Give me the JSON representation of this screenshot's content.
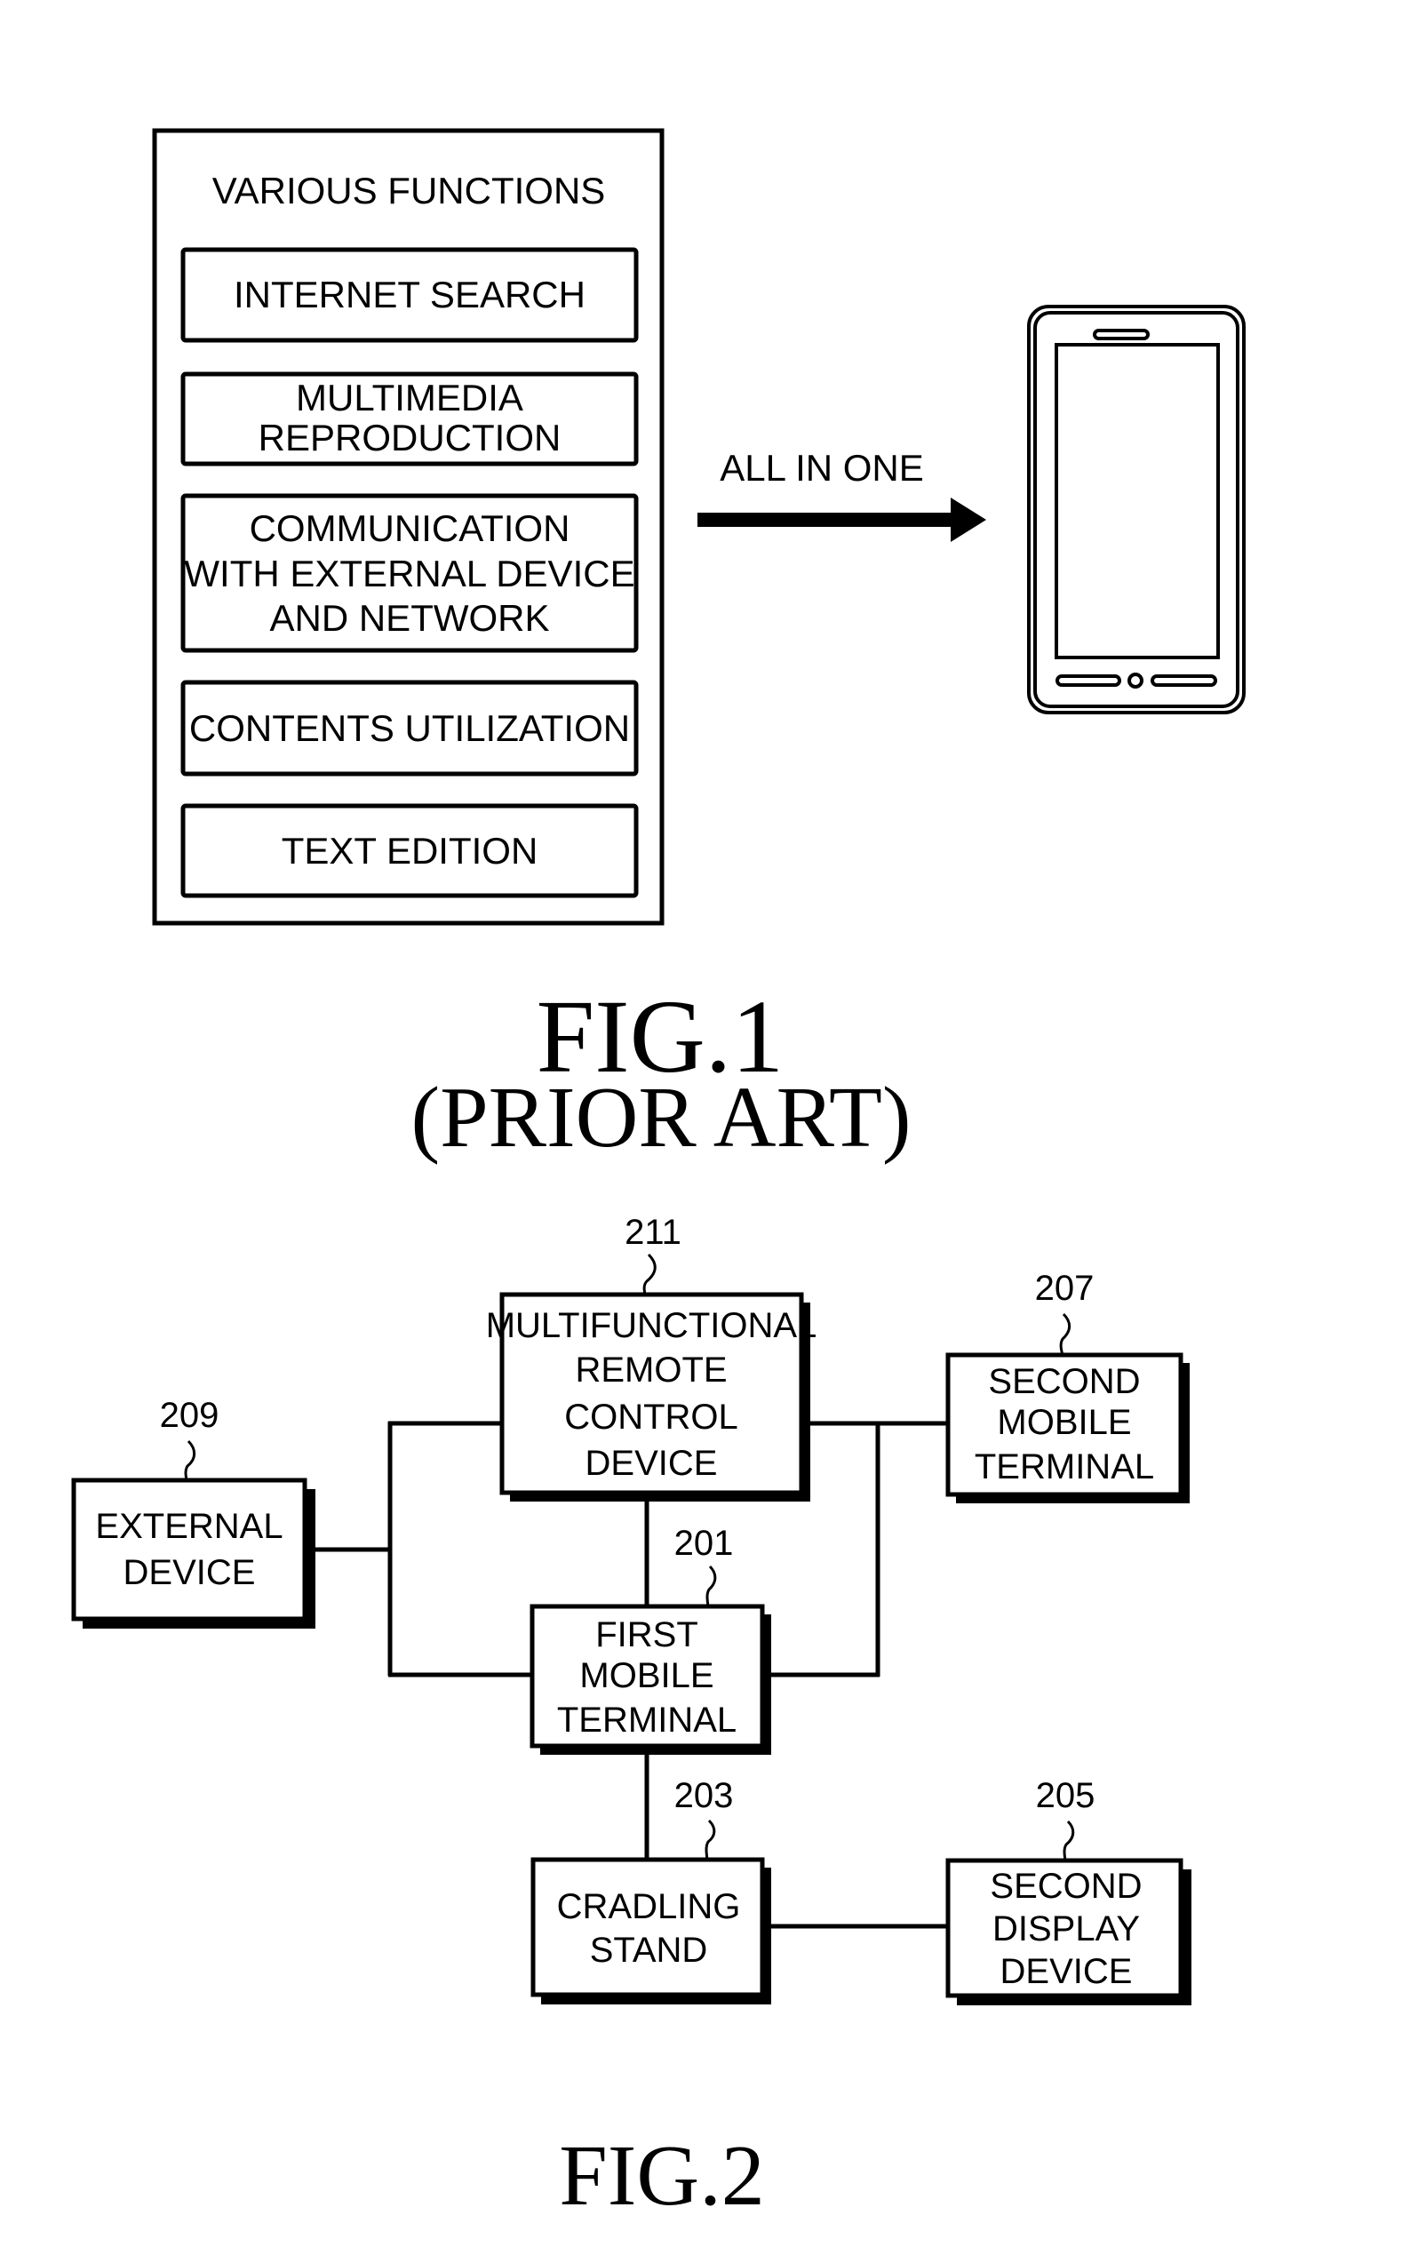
{
  "fig1": {
    "container_title": "VARIOUS FUNCTIONS",
    "functions": [
      {
        "lines": [
          "INTERNET SEARCH"
        ]
      },
      {
        "lines": [
          "MULTIMEDIA",
          "REPRODUCTION"
        ]
      },
      {
        "lines": [
          "COMMUNICATION",
          "WITH EXTERNAL DEVICE",
          "AND NETWORK"
        ]
      },
      {
        "lines": [
          "CONTENTS UTILIZATION"
        ]
      },
      {
        "lines": [
          "TEXT EDITION"
        ]
      }
    ],
    "arrow_label": "ALL IN ONE",
    "device_icon": "mobile-phone-icon",
    "caption": "FIG.1",
    "subcaption": "(PRIOR ART)"
  },
  "fig2": {
    "blocks": {
      "remote": {
        "ref": "211",
        "lines": [
          "MULTIFUNCTIONAL",
          "REMOTE",
          "CONTROL",
          "DEVICE"
        ]
      },
      "second_mobile": {
        "ref": "207",
        "lines": [
          "SECOND",
          "MOBILE",
          "TERMINAL"
        ]
      },
      "external": {
        "ref": "209",
        "lines": [
          "EXTERNAL",
          "DEVICE"
        ]
      },
      "first_mobile": {
        "ref": "201",
        "lines": [
          "FIRST",
          "MOBILE",
          "TERMINAL"
        ]
      },
      "cradle": {
        "ref": "203",
        "lines": [
          "CRADLING",
          "STAND"
        ]
      },
      "second_display": {
        "ref": "205",
        "lines": [
          "SECOND",
          "DISPLAY",
          "DEVICE"
        ]
      }
    },
    "connections": [
      [
        "external",
        "remote"
      ],
      [
        "external",
        "first_mobile"
      ],
      [
        "remote",
        "first_mobile"
      ],
      [
        "remote",
        "second_mobile"
      ],
      [
        "first_mobile",
        "second_mobile"
      ],
      [
        "first_mobile",
        "cradle"
      ],
      [
        "cradle",
        "second_display"
      ]
    ],
    "caption": "FIG.2"
  }
}
